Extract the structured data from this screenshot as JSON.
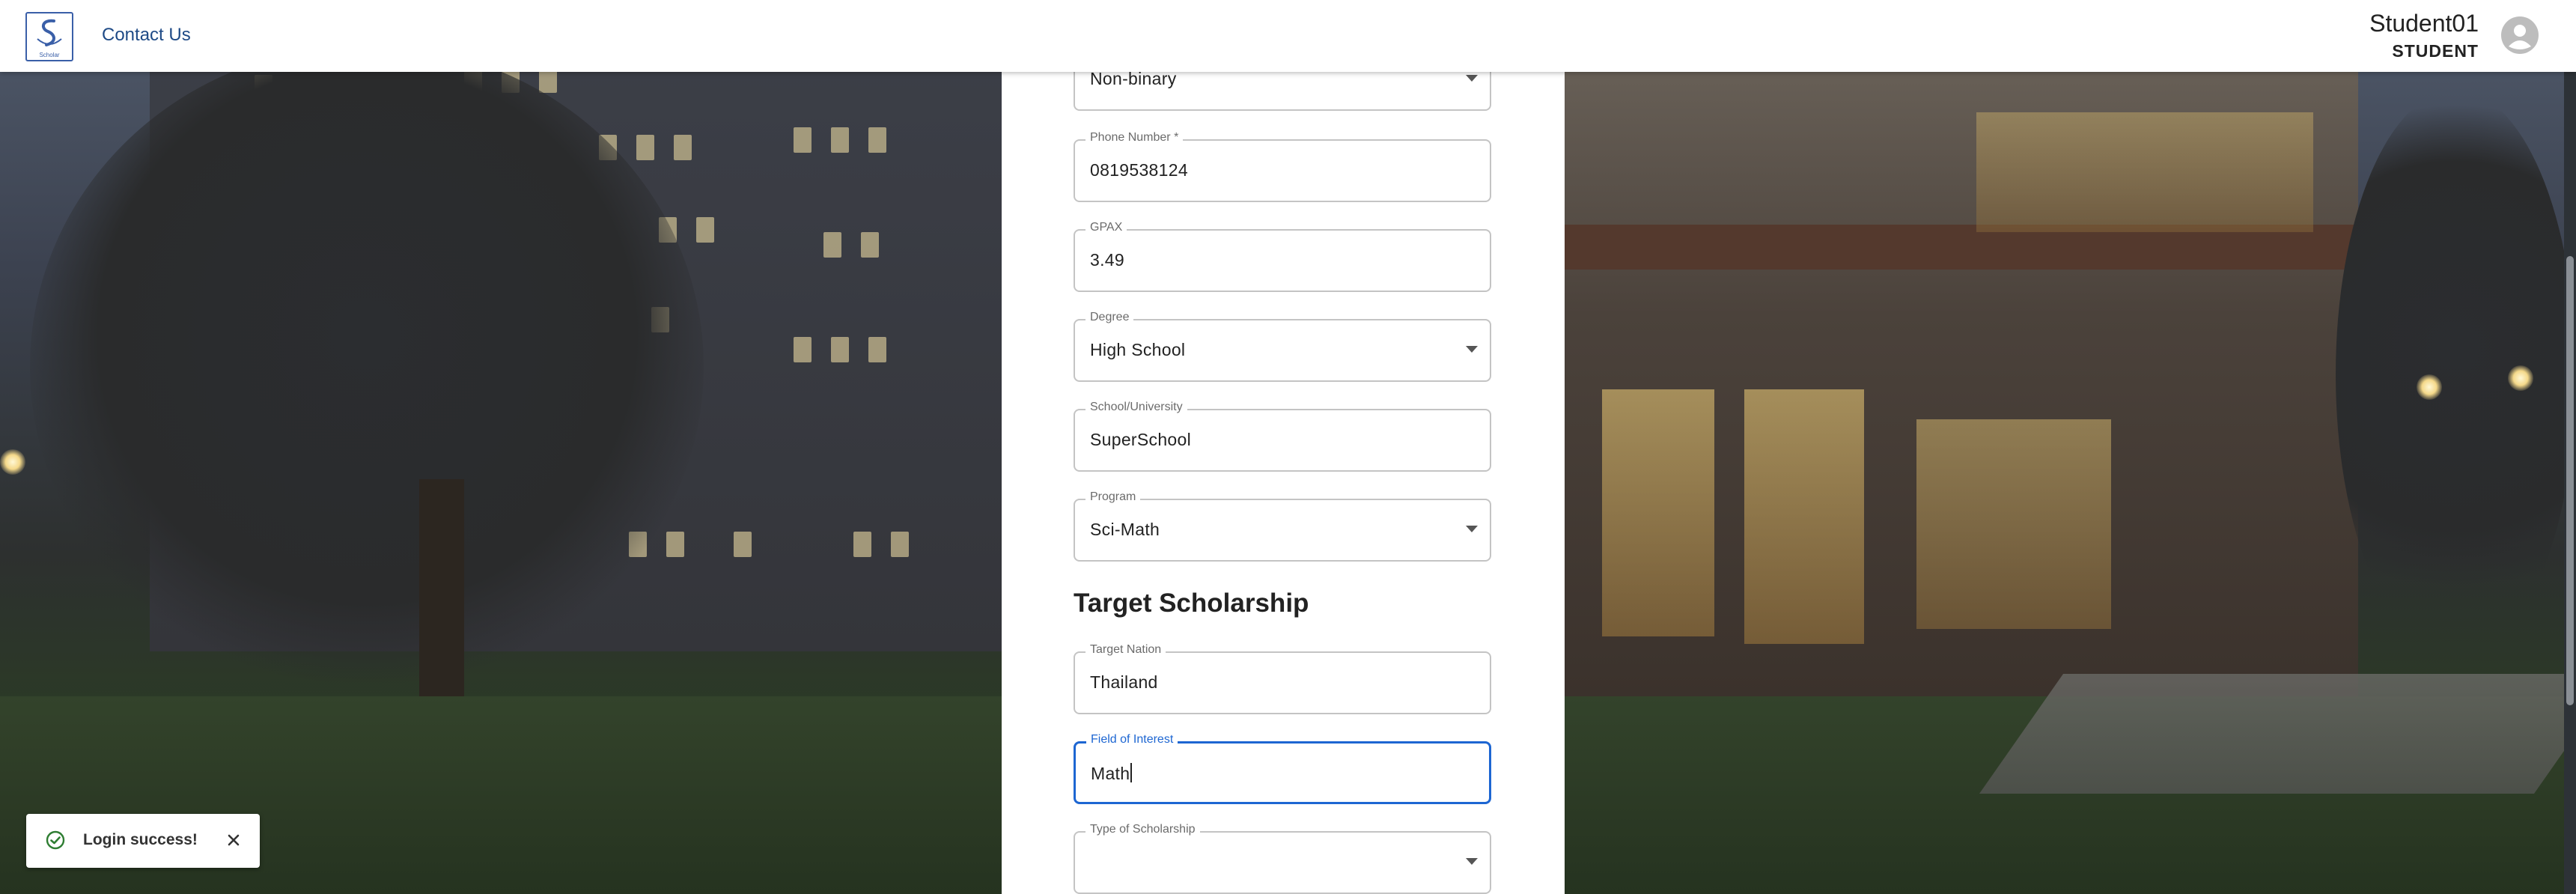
{
  "header": {
    "logo_text": "Scholar",
    "contact_label": "Contact Us",
    "user_name": "Student01",
    "user_role": "STUDENT"
  },
  "form": {
    "gender": {
      "value": "Non-binary"
    },
    "phone": {
      "label": "Phone Number *",
      "value": "0819538124"
    },
    "gpax": {
      "label": "GPAX",
      "value": "3.49"
    },
    "degree": {
      "label": "Degree",
      "value": "High School"
    },
    "school": {
      "label": "School/University",
      "value": "SuperSchool"
    },
    "program": {
      "label": "Program",
      "value": "Sci-Math"
    },
    "target_section_title": "Target Scholarship",
    "target_nation": {
      "label": "Target Nation",
      "value": "Thailand"
    },
    "field_of_interest": {
      "label": "Field of Interest",
      "value": "Math"
    },
    "scholarship_type": {
      "label": "Type of Scholarship",
      "value": ""
    }
  },
  "toast": {
    "message": "Login success!"
  },
  "colors": {
    "accent": "#1d66d2",
    "success": "#2e7d32",
    "link": "#1e4a86"
  }
}
